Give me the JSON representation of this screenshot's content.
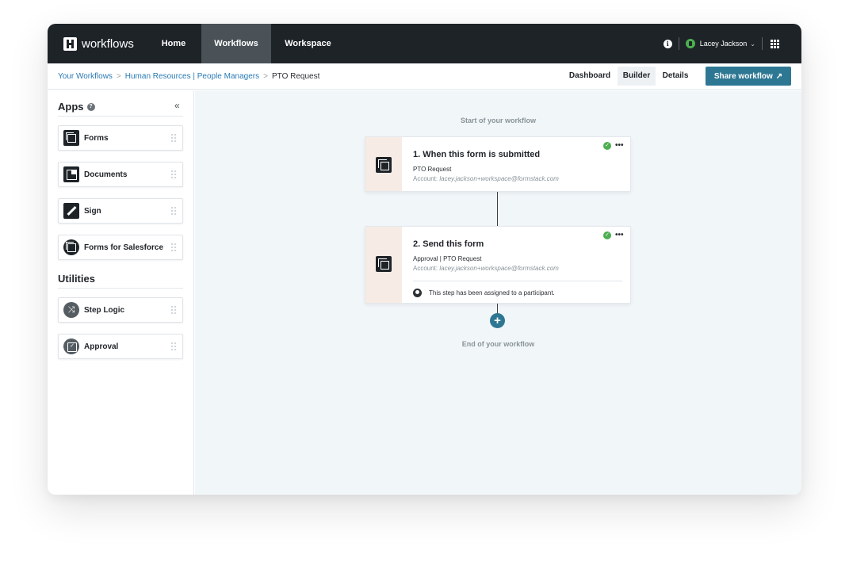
{
  "brand": {
    "name": "workflows"
  },
  "nav": {
    "items": [
      {
        "label": "Home"
      },
      {
        "label": "Workflows"
      },
      {
        "label": "Workspace"
      }
    ],
    "info_icon": "i",
    "user_name": "Lacey Jackson",
    "user_chevron": "⌄"
  },
  "breadcrumb": {
    "items": [
      "Your Workflows",
      "Human Resources | People Managers",
      "PTO Request"
    ],
    "separator": ">"
  },
  "view_tabs": [
    {
      "label": "Dashboard"
    },
    {
      "label": "Builder",
      "active": true
    },
    {
      "label": "Details"
    }
  ],
  "share_button": {
    "label": "Share workflow",
    "arrow": "↗"
  },
  "sidebar": {
    "apps_title": "Apps",
    "help": "?",
    "collapse": "«",
    "apps": [
      {
        "label": "Forms",
        "icon": "forms-icon"
      },
      {
        "label": "Documents",
        "icon": "documents-icon"
      },
      {
        "label": "Sign",
        "icon": "sign-icon"
      },
      {
        "label": "Forms for Salesforce",
        "icon": "salesforce-forms-icon"
      }
    ],
    "utilities_title": "Utilities",
    "utilities": [
      {
        "label": "Step Logic",
        "icon": "step-logic-icon"
      },
      {
        "label": "Approval",
        "icon": "approval-icon"
      }
    ]
  },
  "canvas": {
    "start_label": "Start of your workflow",
    "end_label": "End of your workflow",
    "add_label": "+",
    "steps": [
      {
        "title": "1. When this form is submitted",
        "subtitle": "PTO Request",
        "account_prefix": "Account:",
        "account": "lacey.jackson+workspace@formstack.com",
        "status_glyph": "✓",
        "more": "•••"
      },
      {
        "title": "2. Send this form",
        "subtitle": "Approval | PTO Request",
        "account_prefix": "Account:",
        "account": "lacey.jackson+workspace@formstack.com",
        "status_glyph": "✓",
        "more": "•••",
        "participant_note": "This step has been assigned to a participant."
      }
    ]
  },
  "colors": {
    "nav_bg": "#1e2328",
    "nav_active": "#4a5258",
    "link": "#2a7ab5",
    "primary": "#2e7793",
    "success": "#4caf50",
    "canvas_bg": "#f1f6f9",
    "step_accent": "#f7ebe5"
  }
}
